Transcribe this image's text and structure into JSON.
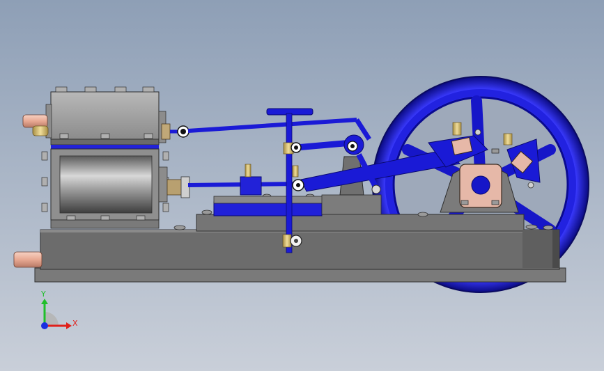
{
  "triad": {
    "x_label": "X",
    "y_label": "Y",
    "x_color": "#e0201a",
    "y_color": "#1fbf2a",
    "z_color": "#1a2fe0"
  },
  "colors": {
    "background_top": "#8e9fb6",
    "background_bottom": "#c9cfd9",
    "model_blue": "#1a1ad6",
    "model_gray": "#8a8a8a",
    "base_gray": "#6e6e6e",
    "brass": "#d7c07a",
    "copper": "#e8b9a8"
  }
}
